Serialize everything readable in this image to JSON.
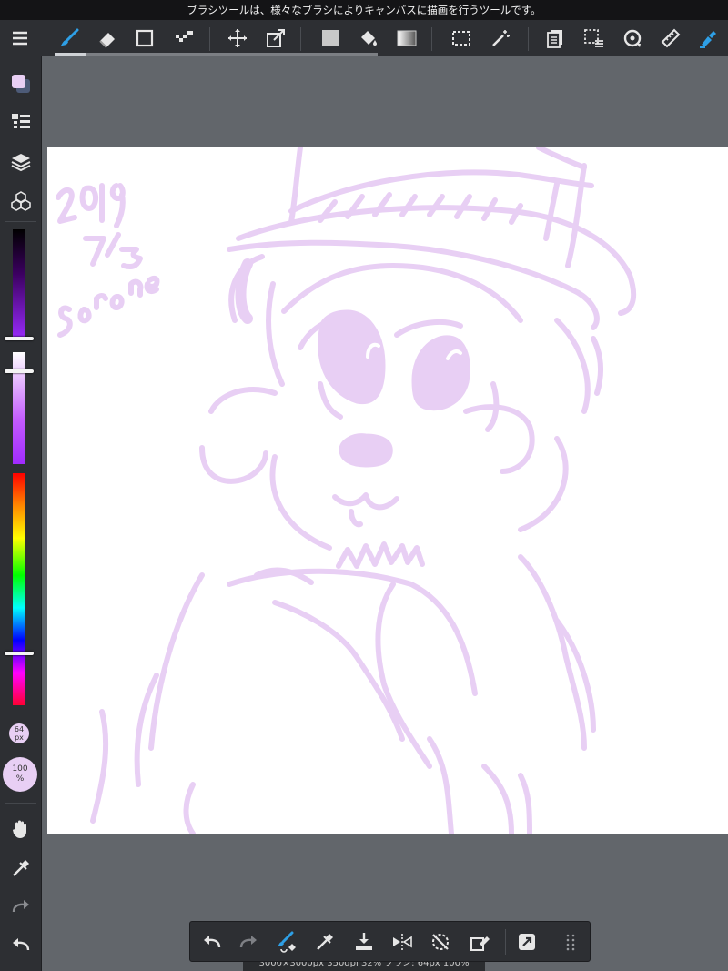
{
  "message_bar": {
    "text": "ブラシツールは、様々なブラシによりキャンバスに描画を行うツールです。"
  },
  "toolbar": {
    "tools": [
      {
        "name": "brush-tool",
        "icon": "brush-icon",
        "active": true
      },
      {
        "name": "eraser-tool",
        "icon": "eraser-icon"
      },
      {
        "name": "shape-tool",
        "icon": "square-icon"
      },
      {
        "name": "dot-tool",
        "icon": "dot-icon"
      },
      {
        "name": "move-tool",
        "icon": "move-icon"
      },
      {
        "name": "transform-tool",
        "icon": "transform-icon"
      },
      {
        "name": "fill-tool",
        "icon": "fill-square-icon"
      },
      {
        "name": "bucket-tool",
        "icon": "bucket-icon"
      },
      {
        "name": "gradient-tool",
        "icon": "gradient-icon"
      },
      {
        "name": "select-tool",
        "icon": "select-rect-icon"
      },
      {
        "name": "magic-wand-tool",
        "icon": "magic-wand-icon"
      },
      {
        "name": "copy-tool",
        "icon": "pages-icon"
      },
      {
        "name": "select-menu-tool",
        "icon": "select-menu-icon"
      },
      {
        "name": "rotate-tool",
        "icon": "rotate-icon"
      },
      {
        "name": "ruler-tool",
        "icon": "ruler-icon"
      },
      {
        "name": "pen-settings-tool",
        "icon": "pen-settings-icon"
      }
    ],
    "accent": "#2e9fe6"
  },
  "sidebar": {
    "size_value": "64",
    "size_unit": "px",
    "opacity_value": "100",
    "opacity_unit": "%",
    "current_color": "#e8cff4",
    "opacity_level": 1.0
  },
  "canvas": {
    "stroke_color": "#e8cff4",
    "signature_text": [
      "2019",
      "7/3",
      "sorone"
    ]
  },
  "status": {
    "text": "3000×3000px 350dpi 32% ブラシ: 64px 100%"
  },
  "bottom_bar": {
    "buttons": [
      "undo-icon",
      "redo-icon",
      "brush-eraser-icon",
      "eyedropper-icon",
      "save-icon",
      "flip-icon",
      "rotate-reset-icon",
      "clear-icon",
      "quick-access-icon",
      "grid-dots-icon"
    ]
  }
}
